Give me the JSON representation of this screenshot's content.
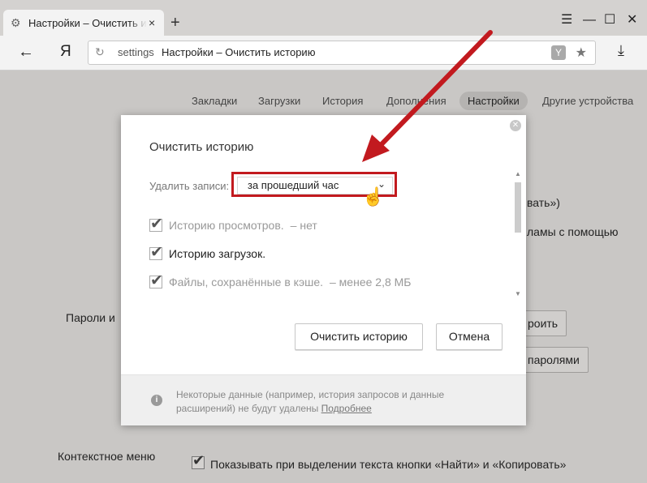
{
  "browser": {
    "tab_title": "Настройки – Очистить и",
    "tab_close": "×",
    "new_tab": "+",
    "omnibox": {
      "host": "settings",
      "title": "Настройки – Очистить историю"
    },
    "brand_letter": "Я"
  },
  "settings_nav": [
    "Закладки",
    "Загрузки",
    "История",
    "Дополнения",
    "Настройки",
    "Другие устройства"
  ],
  "settings_nav_active": "Настройки",
  "background": {
    "partial_1": "вать»)",
    "partial_2": "ламы с помощью",
    "passwords_label": "Пароли и",
    "btn_partial_1": "роить",
    "btn_partial_2": "паролями",
    "context_menu_label": "Контекстное меню",
    "context_menu_option": "Показывать при выделении текста кнопки «Найти» и «Копировать»"
  },
  "dialog": {
    "title": "Очистить историю",
    "delete_label": "Удалить записи:",
    "period_selected": "за прошедший час",
    "options": [
      {
        "label": "Историю просмотров.",
        "detail": "–  нет",
        "checked": true,
        "dim": true
      },
      {
        "label": "Историю загрузок.",
        "detail": "",
        "checked": true,
        "dim": false
      },
      {
        "label": "Файлы, сохранённые в кэше.",
        "detail": "–  менее 2,8 МБ",
        "checked": true,
        "dim": true
      }
    ],
    "clear_button": "Очистить историю",
    "cancel_button": "Отмена",
    "footer_text": "Некоторые данные (например, история запросов и данные расширений) не будут удалены",
    "footer_link": "Подробнее"
  },
  "colors": {
    "annotation_red": "#c21a1f",
    "page_dim": "#c9c7c5"
  }
}
